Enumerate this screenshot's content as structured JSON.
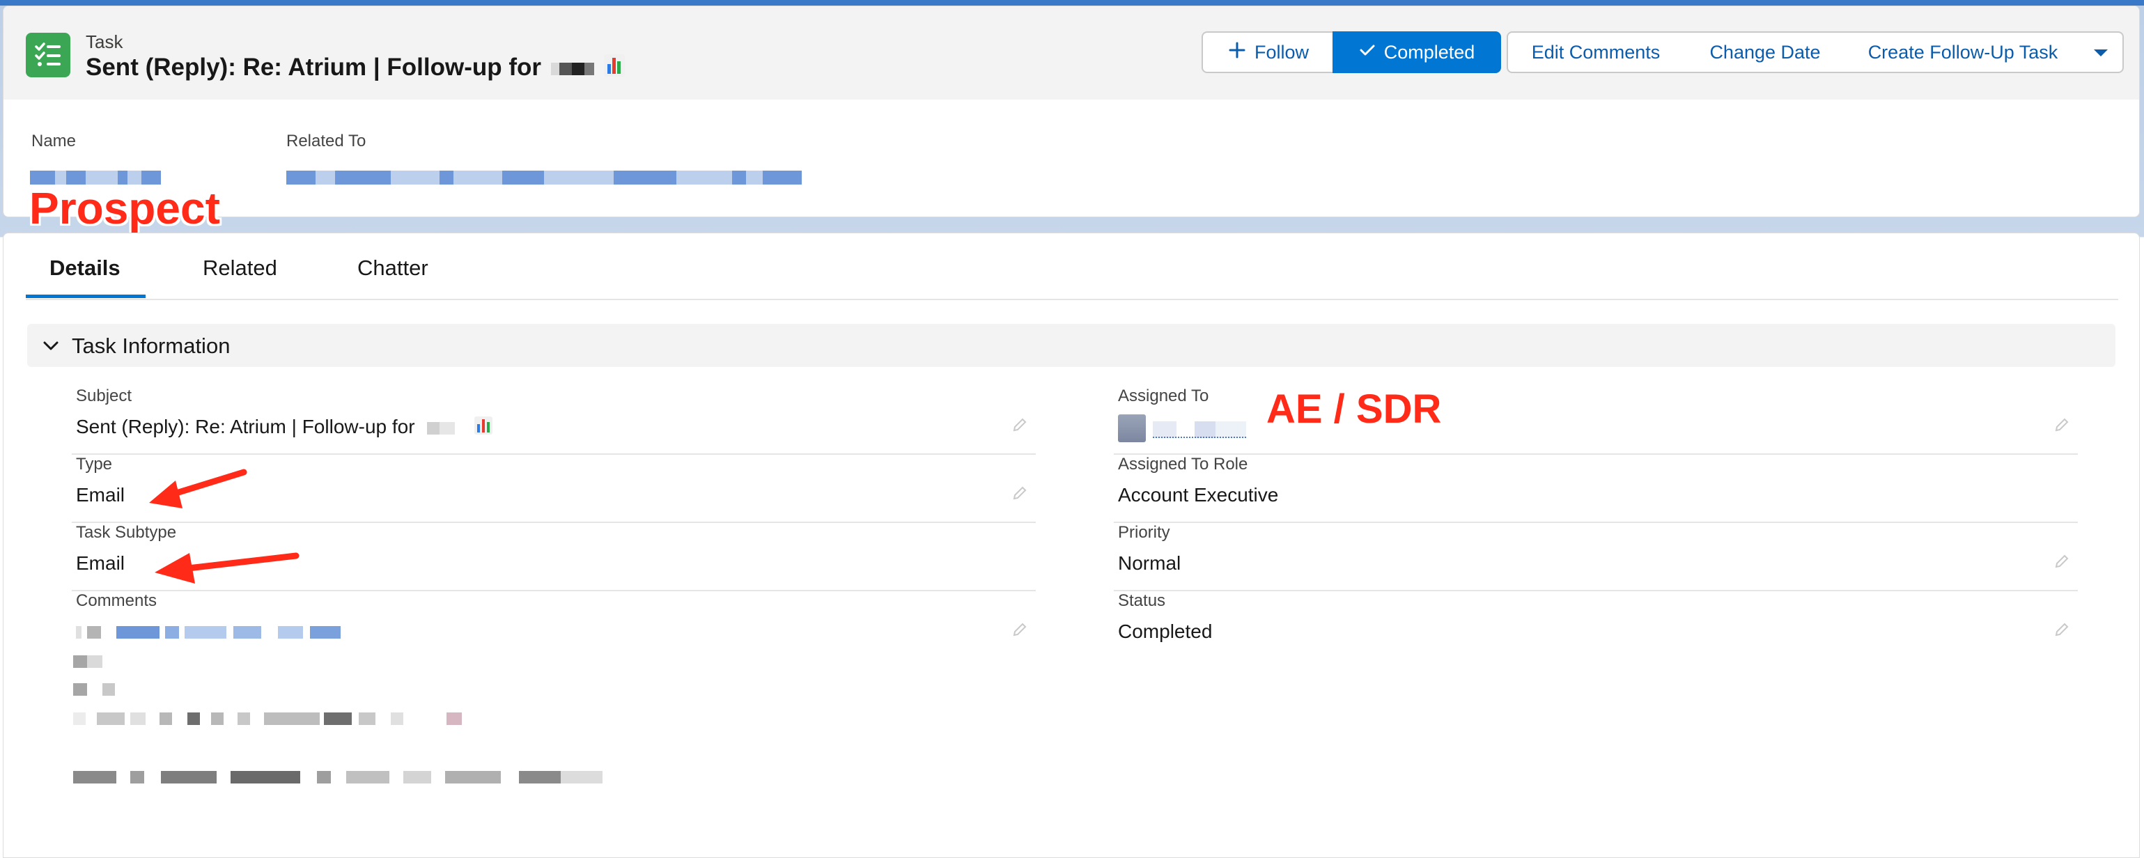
{
  "header": {
    "entity_label": "Task",
    "title": "Sent (Reply): Re: Atrium | Follow-up for",
    "title_emoji": "📊"
  },
  "actions": {
    "follow": "Follow",
    "completed": "Completed",
    "edit_comments": "Edit Comments",
    "change_date": "Change Date",
    "create_follow_up": "Create Follow-Up Task"
  },
  "highlights": {
    "name_label": "Name",
    "related_to_label": "Related To"
  },
  "annotations": {
    "prospect": "Prospect",
    "ae_sdr": "AE / SDR"
  },
  "tabs": [
    "Details",
    "Related",
    "Chatter"
  ],
  "section": {
    "title": "Task Information"
  },
  "fields": {
    "subject": {
      "label": "Subject",
      "value": "Sent (Reply): Re: Atrium | Follow-up for",
      "emoji": "📊"
    },
    "type": {
      "label": "Type",
      "value": "Email"
    },
    "task_subtype": {
      "label": "Task Subtype",
      "value": "Email"
    },
    "comments": {
      "label": "Comments"
    },
    "assigned_to": {
      "label": "Assigned To"
    },
    "assigned_to_role": {
      "label": "Assigned To Role",
      "value": "Account Executive"
    },
    "priority": {
      "label": "Priority",
      "value": "Normal"
    },
    "status": {
      "label": "Status",
      "value": "Completed"
    }
  },
  "colors": {
    "brand": "#0176d3",
    "task_icon": "#3ba755",
    "annotation": "#ff2a17"
  },
  "icons": {
    "task": "task-list-icon",
    "follow": "plus-icon",
    "completed": "check-icon",
    "menu": "caret-down-icon",
    "section": "chevron-down-icon",
    "edit": "pencil-icon"
  }
}
